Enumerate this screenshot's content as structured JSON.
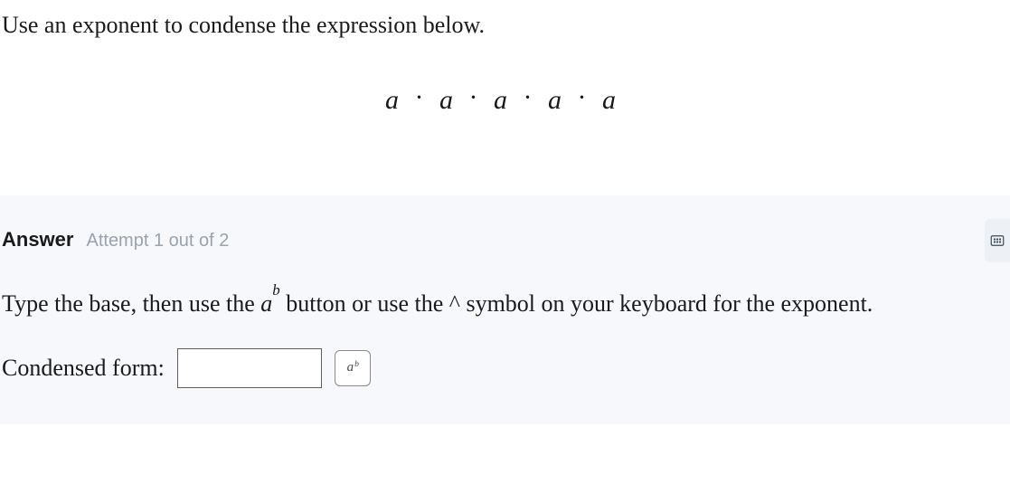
{
  "question": {
    "prompt": "Use an exponent to condense the expression below.",
    "expression_vars": [
      "a",
      "a",
      "a",
      "a",
      "a"
    ]
  },
  "answer_panel": {
    "label": "Answer",
    "attempt_text": "Attempt 1 out of 2",
    "instruction_pre": "Type the base, then use the ",
    "instruction_mid": " button or use the ^ symbol on your keyboard for the exponent.",
    "condensed_label": "Condensed form:",
    "input_value": "",
    "exp_button_base": "a",
    "exp_button_sup": "b",
    "inline_math_base": "a",
    "inline_math_sup": "b"
  }
}
